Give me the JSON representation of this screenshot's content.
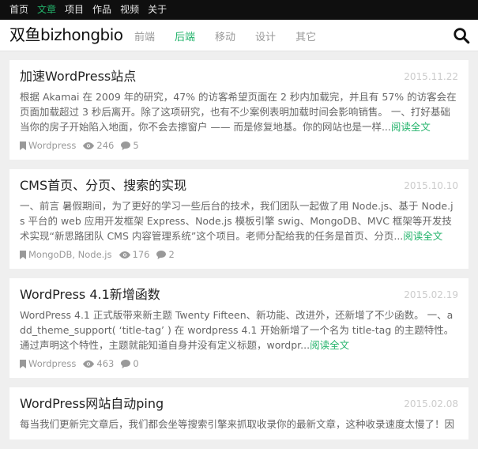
{
  "topnav": {
    "items": [
      {
        "label": "首页"
      },
      {
        "label": "文章"
      },
      {
        "label": "项目"
      },
      {
        "label": "作品"
      },
      {
        "label": "视频"
      },
      {
        "label": "关于"
      }
    ]
  },
  "header": {
    "logo": "双鱼bizhongbio",
    "nav": [
      {
        "label": "前端"
      },
      {
        "label": "后端"
      },
      {
        "label": "移动"
      },
      {
        "label": "设计"
      },
      {
        "label": "其它"
      }
    ]
  },
  "colors": {
    "accent": "#23b36b",
    "topbar": "#0f0f0f"
  },
  "posts": [
    {
      "title": "加速WordPress站点",
      "date": "2015.11.22",
      "excerpt": "根据 Akamai 在 2009 年的研究，47% 的访客希望页面在 2 秒内加载完，并且有 57% 的访客会在页面加载超过 3 秒后离开。除了这项研究，也有不少案例表明加载时间会影响销售。 一、打好基础 当你的房子开始陷入地面，你不会去擦窗户 —— 而是修复地基。你的网站也是一样...",
      "more": "阅读全文",
      "tags": "Wordpress",
      "views": "246",
      "comments": "5"
    },
    {
      "title": "CMS首页、分页、搜索的实现",
      "date": "2015.10.10",
      "excerpt": "一、前言 暑假期间，为了更好的学习一些后台的技术，我们团队一起做了用 Node.js、基于 Node.js 平台的 web 应用开发框架 Express、Node.js 模板引擎 swig、MongoDB、MVC 框架等开发技术实现“新思路团队 CMS 内容管理系统”这个项目。老师分配给我的任务是首页、分页...",
      "more": "阅读全文",
      "tags": "MongoDB, Node.js",
      "views": "176",
      "comments": "2"
    },
    {
      "title": "WordPress 4.1新增函数",
      "date": "2015.02.19",
      "excerpt": "WordPress 4.1 正式版带来新主题 Twenty Fifteen、新功能、改进外，还新增了不少函数。 一、add_theme_support( ‘title-tag’ ) 在 wordpress 4.1 开始新增了一个名为 title-tag 的主题特性。通过声明这个特性，主题就能知道自身并没有定义标题，wordpr...",
      "more": "阅读全文",
      "tags": "Wordpress",
      "views": "463",
      "comments": "0"
    },
    {
      "title": "WordPress网站自动ping",
      "date": "2015.02.08",
      "excerpt": "每当我们更新完文章后，我们都会坐等搜索引擎来抓取收录你的最新文章，这种收录速度太慢了！因"
    }
  ]
}
